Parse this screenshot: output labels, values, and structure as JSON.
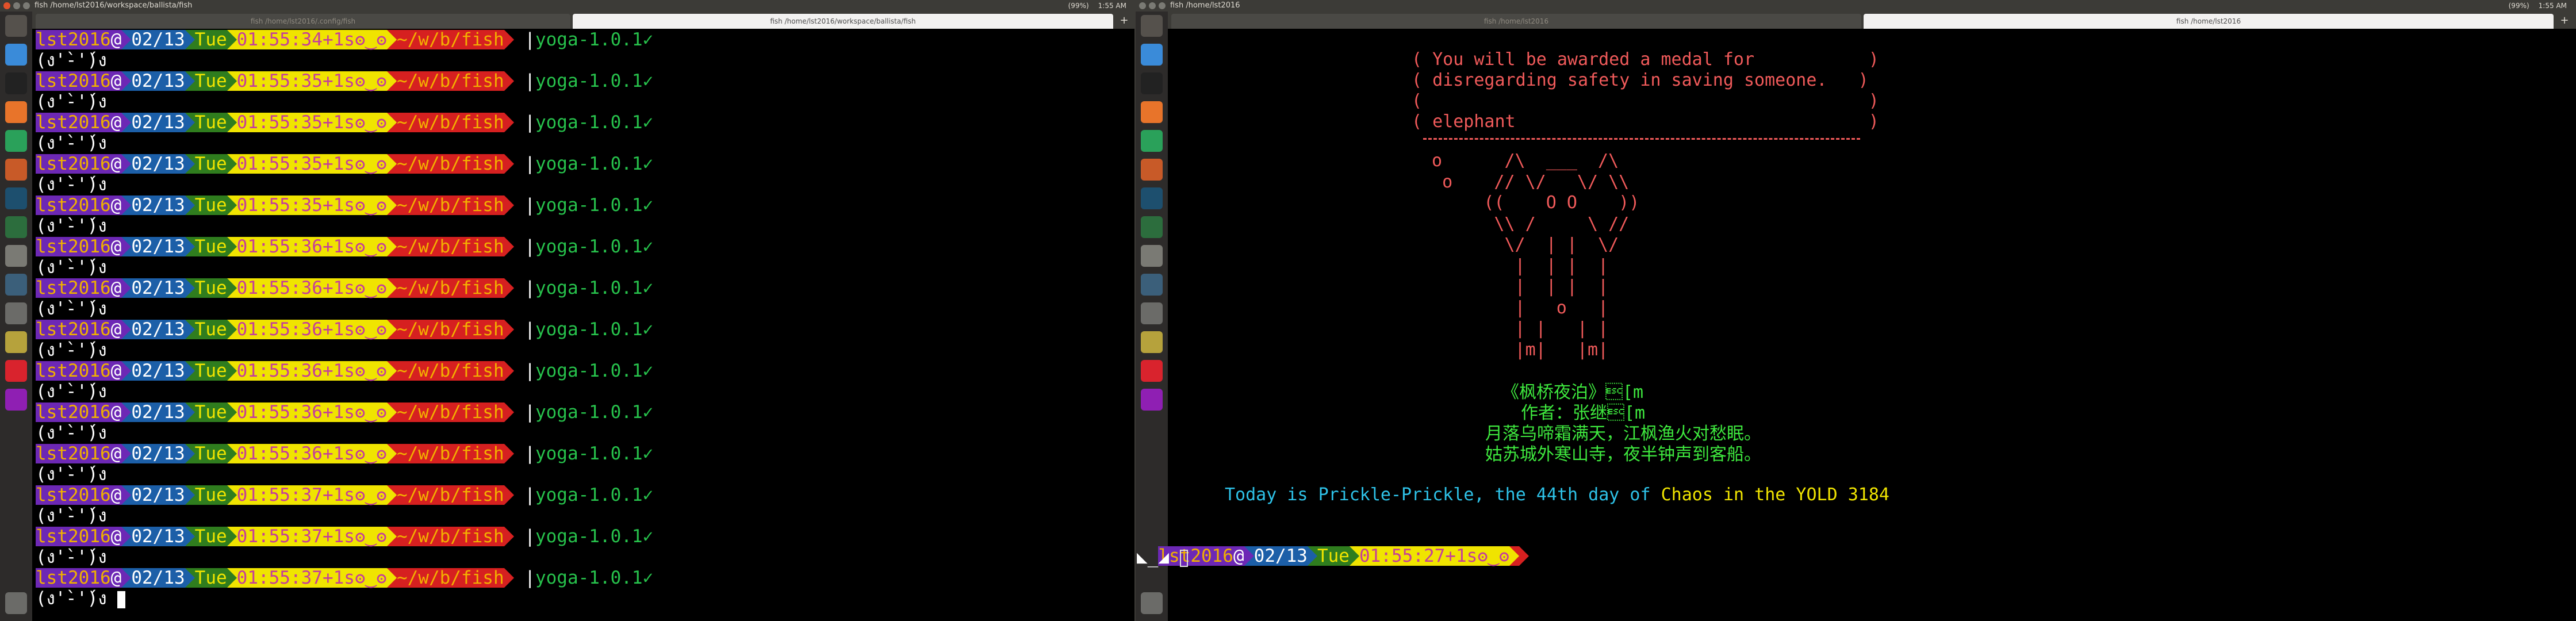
{
  "colors": {
    "prompt_user_bg": "#6d28b5",
    "prompt_date_bg": "#1c5fa8",
    "prompt_day_bg": "#2f7d1e",
    "prompt_time_bg": "#f0e400",
    "prompt_dir_bg": "#d62020",
    "git_text": "#27c24c",
    "cow_text": "#f05a5a",
    "poem_text": "#3ee83e"
  },
  "left": {
    "window_title": "fish  /home/lst2016/workspace/ballista/fish",
    "tabs": [
      {
        "label": "fish  /home/lst2016/.config/fish"
      },
      {
        "label": "fish  /home/lst2016/workspace/ballista/fish"
      }
    ],
    "tab_add": "+",
    "indicators": [
      "(99%)",
      "1:55 AM"
    ],
    "prompts": [
      {
        "user": "lst2016",
        "at": "@",
        "date": "02/13",
        "day": "Tue",
        "time": "01:55:34",
        "duration": "+1s",
        "face": "ʘ‿ʘ",
        "dir": "~/w/b/fish",
        "sep": "|",
        "git": "yoga-1.0.1",
        "check": "✓",
        "face2": "(ง'̀-'́)ง"
      },
      {
        "user": "lst2016",
        "at": "@",
        "date": "02/13",
        "day": "Tue",
        "time": "01:55:35",
        "duration": "+1s",
        "face": "ʘ‿ʘ",
        "dir": "~/w/b/fish",
        "sep": "|",
        "git": "yoga-1.0.1",
        "check": "✓",
        "face2": "(ง'̀-'́)ง"
      },
      {
        "user": "lst2016",
        "at": "@",
        "date": "02/13",
        "day": "Tue",
        "time": "01:55:35",
        "duration": "+1s",
        "face": "ʘ‿ʘ",
        "dir": "~/w/b/fish",
        "sep": "|",
        "git": "yoga-1.0.1",
        "check": "✓",
        "face2": "(ง'̀-'́)ง"
      },
      {
        "user": "lst2016",
        "at": "@",
        "date": "02/13",
        "day": "Tue",
        "time": "01:55:35",
        "duration": "+1s",
        "face": "ʘ‿ʘ",
        "dir": "~/w/b/fish",
        "sep": "|",
        "git": "yoga-1.0.1",
        "check": "✓",
        "face2": "(ง'̀-'́)ง"
      },
      {
        "user": "lst2016",
        "at": "@",
        "date": "02/13",
        "day": "Tue",
        "time": "01:55:35",
        "duration": "+1s",
        "face": "ʘ‿ʘ",
        "dir": "~/w/b/fish",
        "sep": "|",
        "git": "yoga-1.0.1",
        "check": "✓",
        "face2": "(ง'̀-'́)ง"
      },
      {
        "user": "lst2016",
        "at": "@",
        "date": "02/13",
        "day": "Tue",
        "time": "01:55:36",
        "duration": "+1s",
        "face": "ʘ‿ʘ",
        "dir": "~/w/b/fish",
        "sep": "|",
        "git": "yoga-1.0.1",
        "check": "✓",
        "face2": "(ง'̀-'́)ง"
      },
      {
        "user": "lst2016",
        "at": "@",
        "date": "02/13",
        "day": "Tue",
        "time": "01:55:36",
        "duration": "+1s",
        "face": "ʘ‿ʘ",
        "dir": "~/w/b/fish",
        "sep": "|",
        "git": "yoga-1.0.1",
        "check": "✓",
        "face2": "(ง'̀-'́)ง"
      },
      {
        "user": "lst2016",
        "at": "@",
        "date": "02/13",
        "day": "Tue",
        "time": "01:55:36",
        "duration": "+1s",
        "face": "ʘ‿ʘ",
        "dir": "~/w/b/fish",
        "sep": "|",
        "git": "yoga-1.0.1",
        "check": "✓",
        "face2": "(ง'̀-'́)ง"
      },
      {
        "user": "lst2016",
        "at": "@",
        "date": "02/13",
        "day": "Tue",
        "time": "01:55:36",
        "duration": "+1s",
        "face": "ʘ‿ʘ",
        "dir": "~/w/b/fish",
        "sep": "|",
        "git": "yoga-1.0.1",
        "check": "✓",
        "face2": "(ง'̀-'́)ง"
      },
      {
        "user": "lst2016",
        "at": "@",
        "date": "02/13",
        "day": "Tue",
        "time": "01:55:36",
        "duration": "+1s",
        "face": "ʘ‿ʘ",
        "dir": "~/w/b/fish",
        "sep": "|",
        "git": "yoga-1.0.1",
        "check": "✓",
        "face2": "(ง'̀-'́)ง"
      },
      {
        "user": "lst2016",
        "at": "@",
        "date": "02/13",
        "day": "Tue",
        "time": "01:55:36",
        "duration": "+1s",
        "face": "ʘ‿ʘ",
        "dir": "~/w/b/fish",
        "sep": "|",
        "git": "yoga-1.0.1",
        "check": "✓",
        "face2": "(ง'̀-'́)ง"
      },
      {
        "user": "lst2016",
        "at": "@",
        "date": "02/13",
        "day": "Tue",
        "time": "01:55:37",
        "duration": "+1s",
        "face": "ʘ‿ʘ",
        "dir": "~/w/b/fish",
        "sep": "|",
        "git": "yoga-1.0.1",
        "check": "✓",
        "face2": "(ง'̀-'́)ง"
      },
      {
        "user": "lst2016",
        "at": "@",
        "date": "02/13",
        "day": "Tue",
        "time": "01:55:37",
        "duration": "+1s",
        "face": "ʘ‿ʘ",
        "dir": "~/w/b/fish",
        "sep": "|",
        "git": "yoga-1.0.1",
        "check": "✓",
        "face2": "(ง'̀-'́)ง"
      },
      {
        "user": "lst2016",
        "at": "@",
        "date": "02/13",
        "day": "Tue",
        "time": "01:55:37",
        "duration": "+1s",
        "face": "ʘ‿ʘ",
        "dir": "~/w/b/fish",
        "sep": "|",
        "git": "yoga-1.0.1",
        "check": "✓",
        "face2": "(ง'̀-'́)ง"
      }
    ]
  },
  "right": {
    "window_title": "fish  /home/lst2016",
    "tabs": [
      {
        "label": "fish  /home/lst2016"
      },
      {
        "label": "fish  /home/lst2016"
      }
    ],
    "tab_add": "+",
    "indicators": [
      "(99%)",
      "1:55 AM"
    ],
    "cowsay": [
      "( You will be awarded a medal for           )",
      "( disregarding safety in saving someone.   )",
      "(                                           )",
      "( elephant                                  )"
    ],
    "elephant_art": " o      /\\  ___  /\\\n  o    // \\/   \\/ \\\\\n      ((    O O    ))\n       \\\\ /     \\ //\n        \\/  | |  \\/\n         |  | |  |\n         |  | |  |\n         |   o   |\n         | |   | |\n         |m|   |m|",
    "poem_title": "《枫桥夜泊》",
    "poem_title_tail": "\u001b[m",
    "poem_author": "作者：张继",
    "poem_author_tail": "\u001b[m",
    "poem_line1": "月落乌啼霜满天，江枫渔火对愁眠。",
    "poem_line2": "姑苏城外寒山寺，夜半钟声到客船。",
    "today_prefix": "Today is ",
    "today_day": "Prickle-Prickle",
    "today_mid": ", the 44th day of ",
    "today_season": "Chaos",
    "today_mid2": " in the ",
    "today_yold": "YOLD 3184",
    "prompt": {
      "user": "lst2016",
      "at": "@",
      "date": "02/13",
      "day": "Tue",
      "time": "01:55:27",
      "duration": "+1s",
      "face": "ʘ‿ʘ"
    },
    "mode_glyph": "◣_◢"
  }
}
